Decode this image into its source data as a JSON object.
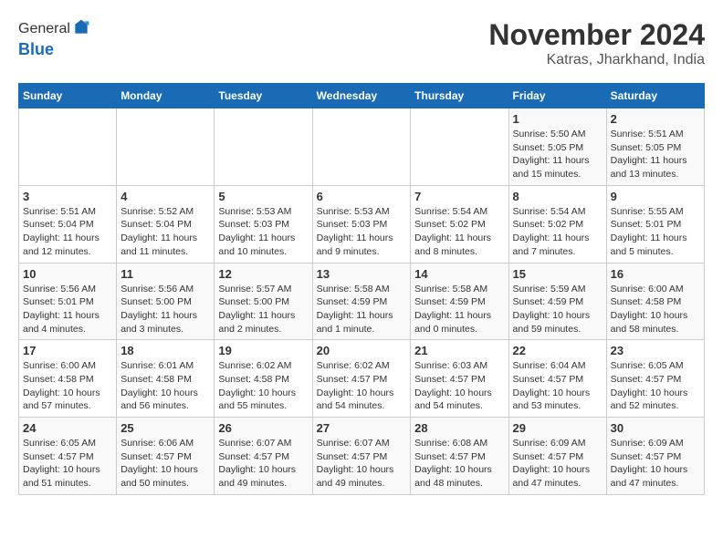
{
  "header": {
    "logo_general": "General",
    "logo_blue": "Blue",
    "month": "November 2024",
    "location": "Katras, Jharkhand, India"
  },
  "weekdays": [
    "Sunday",
    "Monday",
    "Tuesday",
    "Wednesday",
    "Thursday",
    "Friday",
    "Saturday"
  ],
  "weeks": [
    [
      {
        "day": "",
        "info": ""
      },
      {
        "day": "",
        "info": ""
      },
      {
        "day": "",
        "info": ""
      },
      {
        "day": "",
        "info": ""
      },
      {
        "day": "",
        "info": ""
      },
      {
        "day": "1",
        "info": "Sunrise: 5:50 AM\nSunset: 5:05 PM\nDaylight: 11 hours and 15 minutes."
      },
      {
        "day": "2",
        "info": "Sunrise: 5:51 AM\nSunset: 5:05 PM\nDaylight: 11 hours and 13 minutes."
      }
    ],
    [
      {
        "day": "3",
        "info": "Sunrise: 5:51 AM\nSunset: 5:04 PM\nDaylight: 11 hours and 12 minutes."
      },
      {
        "day": "4",
        "info": "Sunrise: 5:52 AM\nSunset: 5:04 PM\nDaylight: 11 hours and 11 minutes."
      },
      {
        "day": "5",
        "info": "Sunrise: 5:53 AM\nSunset: 5:03 PM\nDaylight: 11 hours and 10 minutes."
      },
      {
        "day": "6",
        "info": "Sunrise: 5:53 AM\nSunset: 5:03 PM\nDaylight: 11 hours and 9 minutes."
      },
      {
        "day": "7",
        "info": "Sunrise: 5:54 AM\nSunset: 5:02 PM\nDaylight: 11 hours and 8 minutes."
      },
      {
        "day": "8",
        "info": "Sunrise: 5:54 AM\nSunset: 5:02 PM\nDaylight: 11 hours and 7 minutes."
      },
      {
        "day": "9",
        "info": "Sunrise: 5:55 AM\nSunset: 5:01 PM\nDaylight: 11 hours and 5 minutes."
      }
    ],
    [
      {
        "day": "10",
        "info": "Sunrise: 5:56 AM\nSunset: 5:01 PM\nDaylight: 11 hours and 4 minutes."
      },
      {
        "day": "11",
        "info": "Sunrise: 5:56 AM\nSunset: 5:00 PM\nDaylight: 11 hours and 3 minutes."
      },
      {
        "day": "12",
        "info": "Sunrise: 5:57 AM\nSunset: 5:00 PM\nDaylight: 11 hours and 2 minutes."
      },
      {
        "day": "13",
        "info": "Sunrise: 5:58 AM\nSunset: 4:59 PM\nDaylight: 11 hours and 1 minute."
      },
      {
        "day": "14",
        "info": "Sunrise: 5:58 AM\nSunset: 4:59 PM\nDaylight: 11 hours and 0 minutes."
      },
      {
        "day": "15",
        "info": "Sunrise: 5:59 AM\nSunset: 4:59 PM\nDaylight: 10 hours and 59 minutes."
      },
      {
        "day": "16",
        "info": "Sunrise: 6:00 AM\nSunset: 4:58 PM\nDaylight: 10 hours and 58 minutes."
      }
    ],
    [
      {
        "day": "17",
        "info": "Sunrise: 6:00 AM\nSunset: 4:58 PM\nDaylight: 10 hours and 57 minutes."
      },
      {
        "day": "18",
        "info": "Sunrise: 6:01 AM\nSunset: 4:58 PM\nDaylight: 10 hours and 56 minutes."
      },
      {
        "day": "19",
        "info": "Sunrise: 6:02 AM\nSunset: 4:58 PM\nDaylight: 10 hours and 55 minutes."
      },
      {
        "day": "20",
        "info": "Sunrise: 6:02 AM\nSunset: 4:57 PM\nDaylight: 10 hours and 54 minutes."
      },
      {
        "day": "21",
        "info": "Sunrise: 6:03 AM\nSunset: 4:57 PM\nDaylight: 10 hours and 54 minutes."
      },
      {
        "day": "22",
        "info": "Sunrise: 6:04 AM\nSunset: 4:57 PM\nDaylight: 10 hours and 53 minutes."
      },
      {
        "day": "23",
        "info": "Sunrise: 6:05 AM\nSunset: 4:57 PM\nDaylight: 10 hours and 52 minutes."
      }
    ],
    [
      {
        "day": "24",
        "info": "Sunrise: 6:05 AM\nSunset: 4:57 PM\nDaylight: 10 hours and 51 minutes."
      },
      {
        "day": "25",
        "info": "Sunrise: 6:06 AM\nSunset: 4:57 PM\nDaylight: 10 hours and 50 minutes."
      },
      {
        "day": "26",
        "info": "Sunrise: 6:07 AM\nSunset: 4:57 PM\nDaylight: 10 hours and 49 minutes."
      },
      {
        "day": "27",
        "info": "Sunrise: 6:07 AM\nSunset: 4:57 PM\nDaylight: 10 hours and 49 minutes."
      },
      {
        "day": "28",
        "info": "Sunrise: 6:08 AM\nSunset: 4:57 PM\nDaylight: 10 hours and 48 minutes."
      },
      {
        "day": "29",
        "info": "Sunrise: 6:09 AM\nSunset: 4:57 PM\nDaylight: 10 hours and 47 minutes."
      },
      {
        "day": "30",
        "info": "Sunrise: 6:09 AM\nSunset: 4:57 PM\nDaylight: 10 hours and 47 minutes."
      }
    ]
  ]
}
